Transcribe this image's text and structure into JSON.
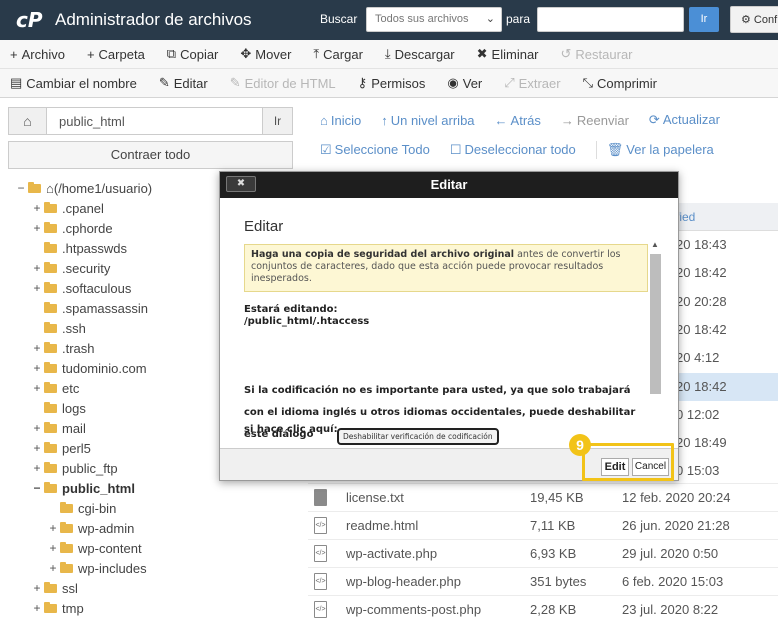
{
  "header": {
    "logo": "cP",
    "title": "Administrador de archivos",
    "search_label": "Buscar",
    "search_scope": "Todos sus archivos",
    "for_label": "para",
    "search_value": "",
    "go_label": "Ir",
    "settings_label": "Conf"
  },
  "toolbar": {
    "row1": [
      {
        "icon": "plus-icon",
        "glyph": "+",
        "label": "Archivo",
        "disabled": false
      },
      {
        "icon": "plus-icon",
        "glyph": "+",
        "label": "Carpeta",
        "disabled": false
      },
      {
        "icon": "copy-icon",
        "glyph": "⧉",
        "label": "Copiar",
        "disabled": false
      },
      {
        "icon": "move-icon",
        "glyph": "✥",
        "label": "Mover",
        "disabled": false
      },
      {
        "icon": "upload-icon",
        "glyph": "⤒",
        "label": "Cargar",
        "disabled": false
      },
      {
        "icon": "download-icon",
        "glyph": "⤓",
        "label": "Descargar",
        "disabled": false
      },
      {
        "icon": "delete-icon",
        "glyph": "✖",
        "label": "Eliminar",
        "disabled": false
      },
      {
        "icon": "restore-icon",
        "glyph": "↺",
        "label": "Restaurar",
        "disabled": true
      }
    ],
    "row2": [
      {
        "icon": "rename-icon",
        "glyph": "▤",
        "label": "Cambiar el nombre",
        "disabled": false
      },
      {
        "icon": "pencil-icon",
        "glyph": "✎",
        "label": "Editar",
        "disabled": false
      },
      {
        "icon": "html-editor-icon",
        "glyph": "✎",
        "label": "Editor de HTML",
        "disabled": true
      },
      {
        "icon": "key-icon",
        "glyph": "⚷",
        "label": "Permisos",
        "disabled": false
      },
      {
        "icon": "eye-icon",
        "glyph": "◉",
        "label": "Ver",
        "disabled": false
      },
      {
        "icon": "extract-icon",
        "glyph": "⤢",
        "label": "Extraer",
        "disabled": true
      },
      {
        "icon": "compress-icon",
        "glyph": "⤡",
        "label": "Comprimir",
        "disabled": false
      }
    ]
  },
  "sidebar": {
    "path_value": "public_html",
    "go_label": "Ir",
    "collapse_label": "Contraer todo",
    "tree": [
      {
        "pm": "−",
        "label": "(/home1/usuario)",
        "home": true,
        "bold": false
      },
      {
        "pm": "+",
        "label": ".cpanel",
        "home": false,
        "bold": false
      },
      {
        "pm": "+",
        "label": ".cphorde",
        "home": false,
        "bold": false
      },
      {
        "pm": "",
        "label": ".htpasswds",
        "home": false,
        "bold": false
      },
      {
        "pm": "+",
        "label": ".security",
        "home": false,
        "bold": false
      },
      {
        "pm": "+",
        "label": ".softaculous",
        "home": false,
        "bold": false
      },
      {
        "pm": "",
        "label": ".spamassassin",
        "home": false,
        "bold": false
      },
      {
        "pm": "",
        "label": ".ssh",
        "home": false,
        "bold": false
      },
      {
        "pm": "+",
        "label": ".trash",
        "home": false,
        "bold": false
      },
      {
        "pm": "+",
        "label": "tudominio.com",
        "home": false,
        "bold": false
      },
      {
        "pm": "+",
        "label": "etc",
        "home": false,
        "bold": false
      },
      {
        "pm": "",
        "label": "logs",
        "home": false,
        "bold": false
      },
      {
        "pm": "+",
        "label": "mail",
        "home": false,
        "bold": false
      },
      {
        "pm": "+",
        "label": "perl5",
        "home": false,
        "bold": false
      },
      {
        "pm": "+",
        "label": "public_ftp",
        "home": false,
        "bold": false
      },
      {
        "pm": "−",
        "label": "public_html",
        "home": false,
        "bold": true
      },
      {
        "pm": "",
        "label": "cgi-bin",
        "home": false,
        "bold": false
      },
      {
        "pm": "+",
        "label": "wp-admin",
        "home": false,
        "bold": false
      },
      {
        "pm": "+",
        "label": "wp-content",
        "home": false,
        "bold": false
      },
      {
        "pm": "+",
        "label": "wp-includes",
        "home": false,
        "bold": false
      },
      {
        "pm": "+",
        "label": "ssl",
        "home": false,
        "bold": false
      },
      {
        "pm": "+",
        "label": "tmp",
        "home": false,
        "bold": false
      }
    ]
  },
  "main": {
    "nav": [
      {
        "icon": "home-icon",
        "glyph": "⌂",
        "label": "Inicio",
        "disabled": false
      },
      {
        "icon": "up-level-icon",
        "glyph": "↑",
        "label": "Un nivel arriba",
        "disabled": false
      },
      {
        "icon": "back-icon",
        "glyph": "←",
        "label": "Atrás",
        "disabled": false
      },
      {
        "icon": "forward-icon",
        "glyph": "→",
        "label": "Reenviar",
        "disabled": true
      },
      {
        "icon": "refresh-icon",
        "glyph": "⟳",
        "label": "Actualizar",
        "disabled": false
      }
    ],
    "select_all": "Seleccione Todo",
    "deselect_all": "Deseleccionar todo",
    "trash": "Ver la papelera",
    "col_modified": "fied",
    "partial_dates": [
      "20 18:43",
      "20 18:42",
      "20 20:28",
      "20 18:42",
      "20 4:12",
      "20 18:42",
      "0 12:02",
      "20 18:49",
      "0 15:03"
    ],
    "files": [
      {
        "icon": "txt",
        "name": "license.txt",
        "size": "19,45 KB",
        "date": "12 feb. 2020 20:24"
      },
      {
        "icon": "code",
        "name": "readme.html",
        "size": "7,11 KB",
        "date": "26 jun. 2020 21:28"
      },
      {
        "icon": "code",
        "name": "wp-activate.php",
        "size": "6,93 KB",
        "date": "29 jul. 2020 0:50"
      },
      {
        "icon": "code",
        "name": "wp-blog-header.php",
        "size": "351 bytes",
        "date": "6 feb. 2020 15:03"
      },
      {
        "icon": "code",
        "name": "wp-comments-post.php",
        "size": "2,28 KB",
        "date": "23 jul. 2020 8:22"
      }
    ]
  },
  "dialog": {
    "close_label": "✖",
    "title": "Editar",
    "heading": "Editar",
    "warning_bold": "Haga una copia de seguridad del archivo original",
    "warning_rest": " antes de convertir los conjuntos de caracteres, dado que esta acción puede provocar resultados inesperados.",
    "editing_label": "Estará editando:",
    "editing_path": "/public_html/.htaccess",
    "encoding_text": "Si la codificación no es importante para usted, ya que solo trabajará con el idioma inglés u otros idiomas occidentales, puede deshabilitar este diálogo",
    "click_here": "si hace clic aquí:",
    "disable_button": "Deshabilitar verificación de codificación",
    "edit_button": "Edit",
    "cancel_button": "Cancel"
  },
  "annotation": {
    "step": "9",
    "color": "#f2c318"
  },
  "colors": {
    "header_bg": "#293a4a",
    "link": "#5b8fc8",
    "folder": "#e8b74a"
  }
}
